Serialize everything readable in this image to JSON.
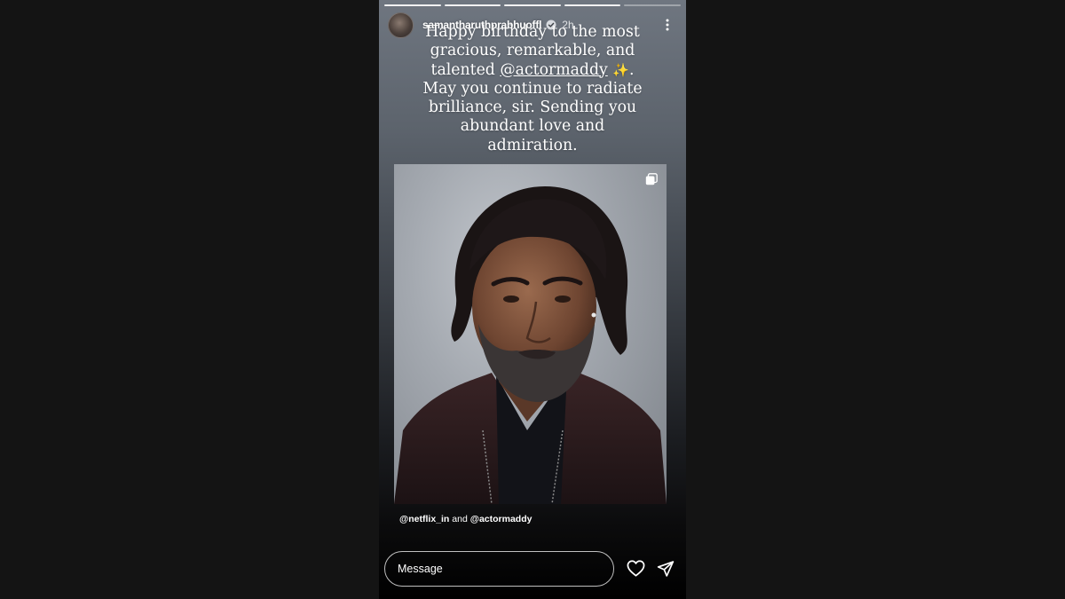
{
  "story": {
    "progress_segments": [
      {
        "state": "done"
      },
      {
        "state": "done"
      },
      {
        "state": "done"
      },
      {
        "state": "done"
      },
      {
        "state": "active"
      }
    ],
    "username": "samantharuthprabhuoffl",
    "verified_icon": "verified-badge-icon",
    "timestamp": "2h",
    "more_icon": "more-vertical-icon",
    "caption": {
      "line1": "Happy birthday to the most",
      "line2": "gracious, remarkable, and",
      "line3_prefix": "talented ",
      "mention": "@actormaddy",
      "emoji": "✨",
      "line3_suffix": ".",
      "line4": "May you continue to radiate",
      "line5": "brilliance, sir. Sending you",
      "line6": "abundant love and",
      "line7": "admiration."
    },
    "photo": {
      "multi_icon": "carousel-icon"
    },
    "tags": {
      "first": "@netflix_in",
      "joiner": " and ",
      "second": "@actormaddy"
    },
    "reply": {
      "placeholder": "Message",
      "heart_icon": "heart-icon",
      "send_icon": "send-icon"
    }
  },
  "colors": {
    "page_background": "#141414",
    "story_top": "#6f7680",
    "story_bottom": "#000000",
    "emoji": "#f3c94b"
  }
}
